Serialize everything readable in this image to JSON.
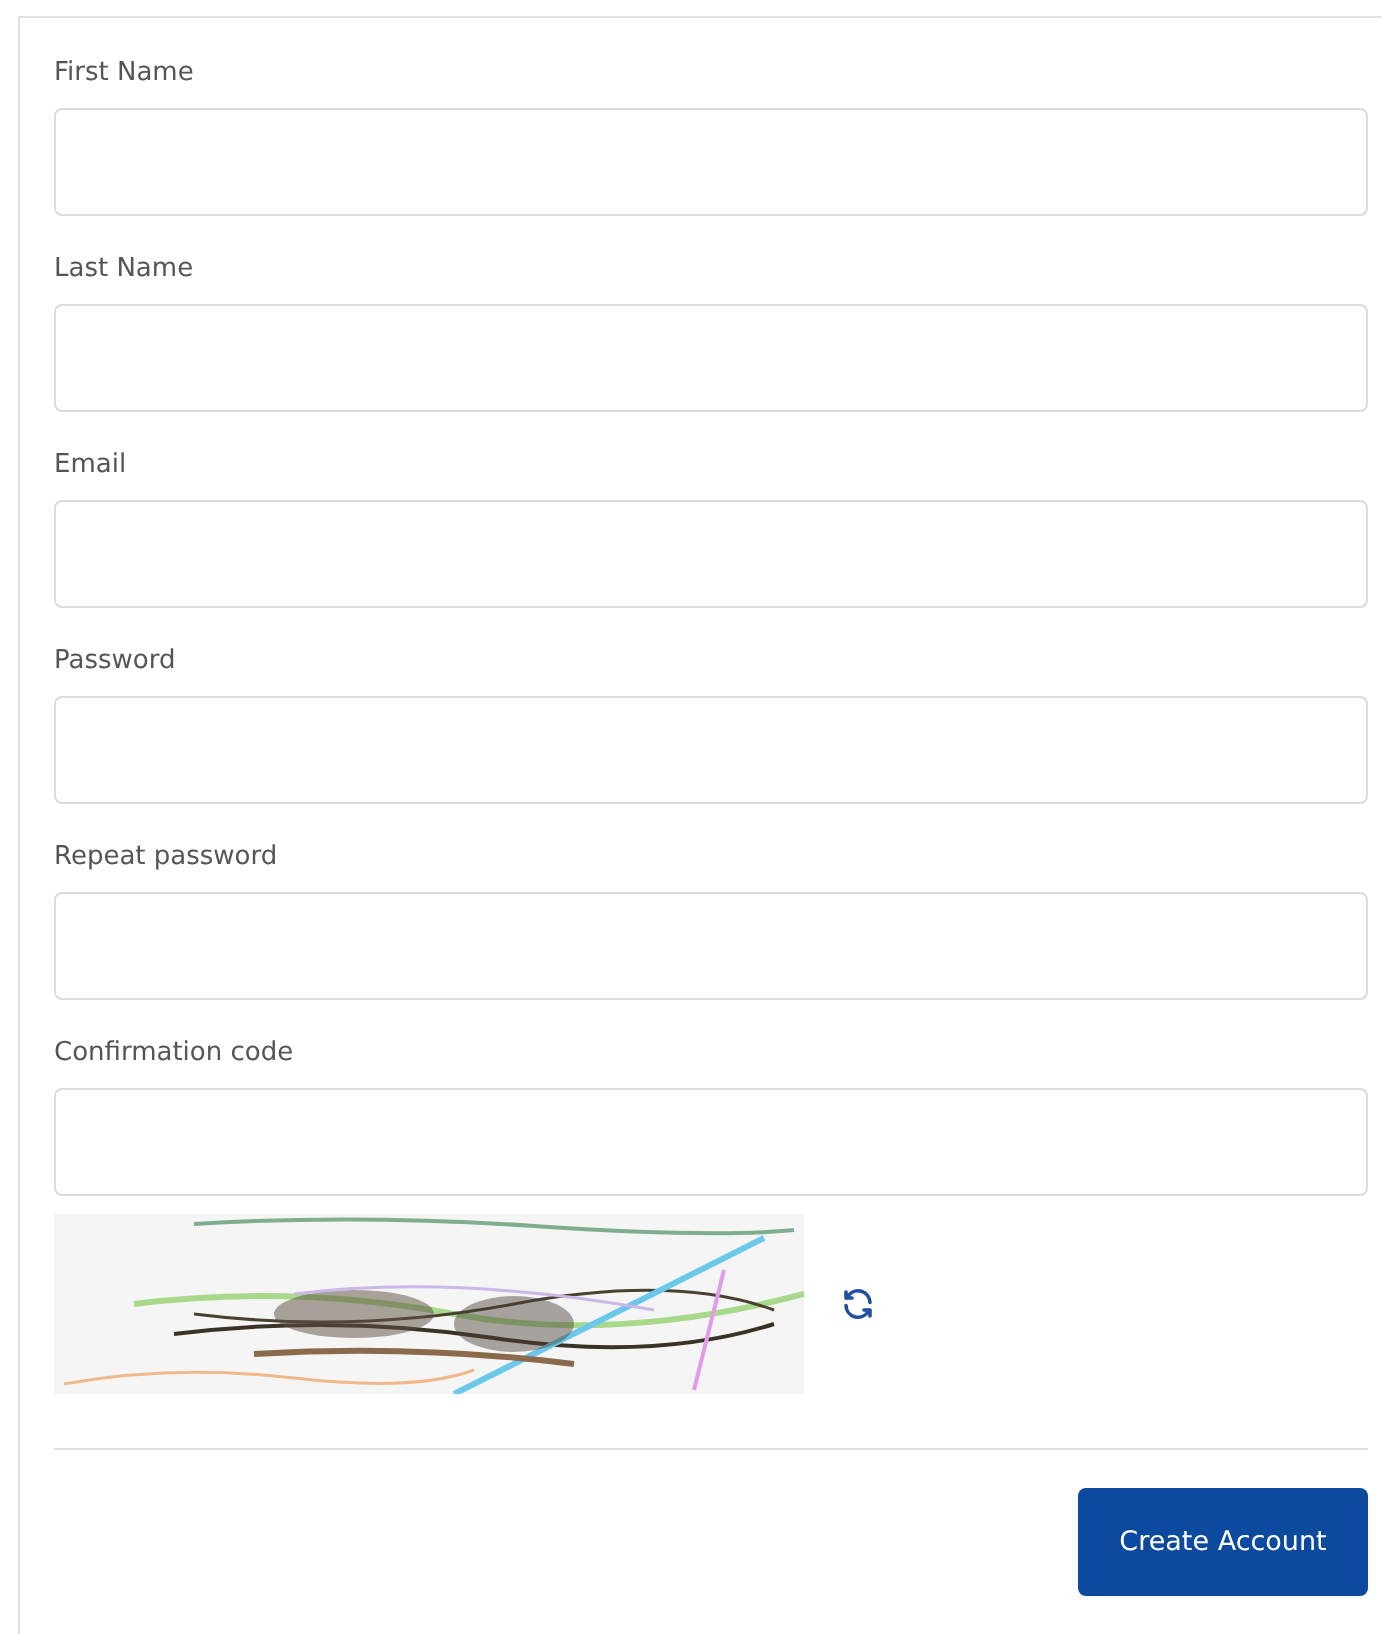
{
  "fields": [
    {
      "label": "First Name"
    },
    {
      "label": "Last Name"
    },
    {
      "label": "Email"
    },
    {
      "label": "Password"
    },
    {
      "label": "Repeat password"
    },
    {
      "label": "Confirmation code"
    }
  ],
  "submit_button": "Create Account"
}
